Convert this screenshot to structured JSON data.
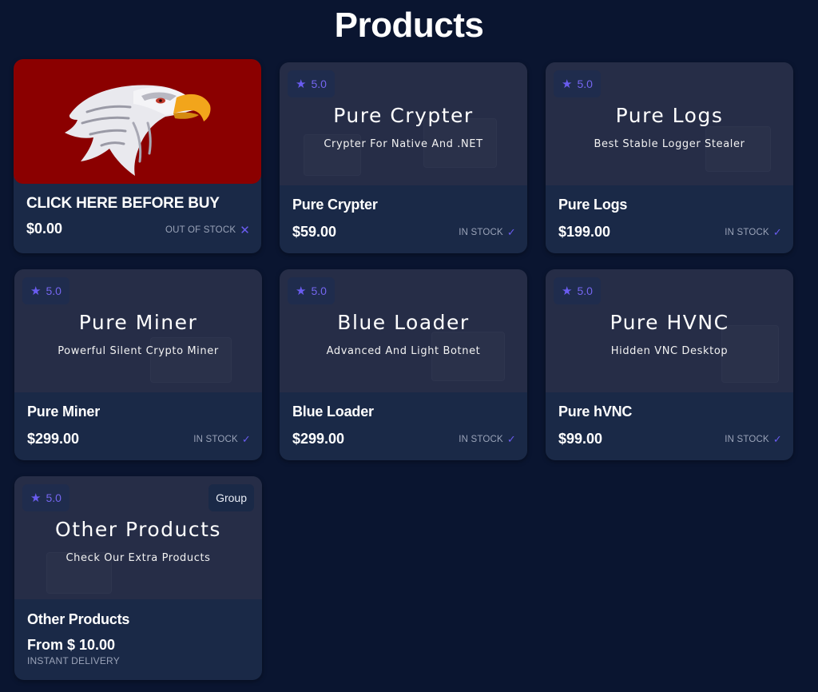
{
  "page": {
    "title": "Products"
  },
  "colors": {
    "background": "#0a1530",
    "card": "#1a2947",
    "banner": "#262d47",
    "accent": "#6a5cf0",
    "featured_banner": "#8b0000"
  },
  "products": [
    {
      "name": "CLICK HERE BEFORE BUY",
      "price": "$0.00",
      "stock": "OUT OF STOCK",
      "stock_icon": "x-icon",
      "banner_image": "eagle-head-logo"
    },
    {
      "name": "Pure Crypter",
      "price": "$59.00",
      "stock": "IN STOCK",
      "stock_icon": "check-icon",
      "rating": "5.0",
      "banner_title": "Pure Crypter",
      "banner_subtitle": "Crypter For Native And .NET"
    },
    {
      "name": "Pure Logs",
      "price": "$199.00",
      "stock": "IN STOCK",
      "stock_icon": "check-icon",
      "rating": "5.0",
      "banner_title": "Pure Logs",
      "banner_subtitle": "Best Stable Logger Stealer"
    },
    {
      "name": "Pure Miner",
      "price": "$299.00",
      "stock": "IN STOCK",
      "stock_icon": "check-icon",
      "rating": "5.0",
      "banner_title": "Pure Miner",
      "banner_subtitle": "Powerful Silent Crypto Miner"
    },
    {
      "name": "Blue Loader",
      "price": "$299.00",
      "stock": "IN STOCK",
      "stock_icon": "check-icon",
      "rating": "5.0",
      "banner_title": "Blue Loader",
      "banner_subtitle": "Advanced And Light Botnet"
    },
    {
      "name": "Pure hVNC",
      "price": "$99.00",
      "stock": "IN STOCK",
      "stock_icon": "check-icon",
      "rating": "5.0",
      "banner_title": "Pure HVNC",
      "banner_subtitle": "Hidden VNC Desktop"
    },
    {
      "name": "Other Products",
      "price": "From $ 10.00",
      "delivery": "INSTANT DELIVERY",
      "rating": "5.0",
      "badge": "Group",
      "banner_title": "Other Products",
      "banner_subtitle": "Check  Our Extra Products"
    }
  ]
}
